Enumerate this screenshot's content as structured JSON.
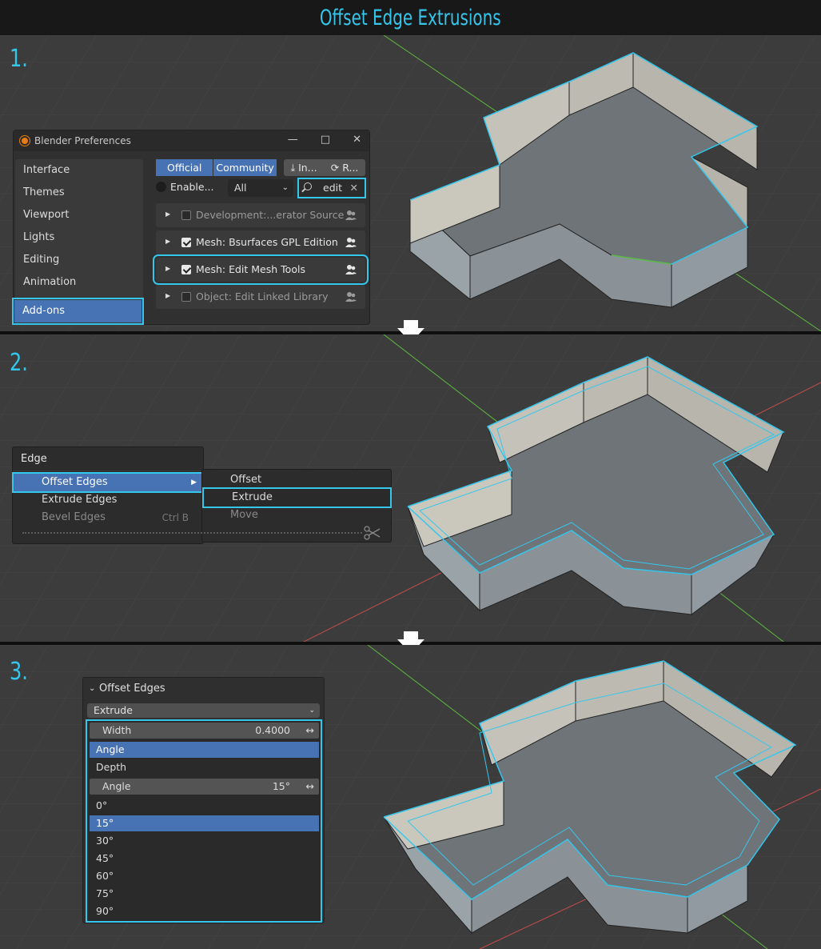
{
  "title": "Offset Edge Extrusions",
  "steps": [
    "1.",
    "2.",
    "3."
  ],
  "prefs": {
    "window_title": "Blender Preferences",
    "sidebar": [
      "Interface",
      "Themes",
      "Viewport",
      "Lights",
      "Editing",
      "Animation"
    ],
    "sidebar_active": "Add-ons",
    "tabs": [
      "Official",
      "Community"
    ],
    "install": "In...",
    "refresh": "R...",
    "enabled_filter": "Enable...",
    "category": "All",
    "search_value": "edit",
    "addons": [
      {
        "label": "Development:...erator Source",
        "checked": false
      },
      {
        "label": "Mesh: Bsurfaces GPL Edition",
        "checked": true
      },
      {
        "label": "Mesh: Edit Mesh Tools",
        "checked": true
      },
      {
        "label": "Object: Edit Linked Library",
        "checked": false
      }
    ]
  },
  "edge_menu": {
    "header": "Edge",
    "items": [
      {
        "label": "Offset Edges",
        "shortcut": ""
      },
      {
        "label": "Extrude Edges",
        "shortcut": ""
      },
      {
        "label": "Bevel Edges",
        "shortcut": "Ctrl B"
      }
    ],
    "submenu": [
      "Offset",
      "Extrude",
      "Move"
    ]
  },
  "offset_panel": {
    "header": "Offset Edges",
    "mode": "Extrude",
    "width_label": "Width",
    "width_value": "0.4000",
    "geometry_options": [
      "Angle",
      "Depth"
    ],
    "angle_label": "Angle",
    "angle_value": "15°",
    "angle_options": [
      "0°",
      "15°",
      "30°",
      "45°",
      "60°",
      "75°",
      "90°"
    ]
  },
  "colors": {
    "accent": "#35c6ec",
    "selected": "#4772b3",
    "axis_x": "#c84a4a",
    "axis_y": "#5fb83d"
  }
}
